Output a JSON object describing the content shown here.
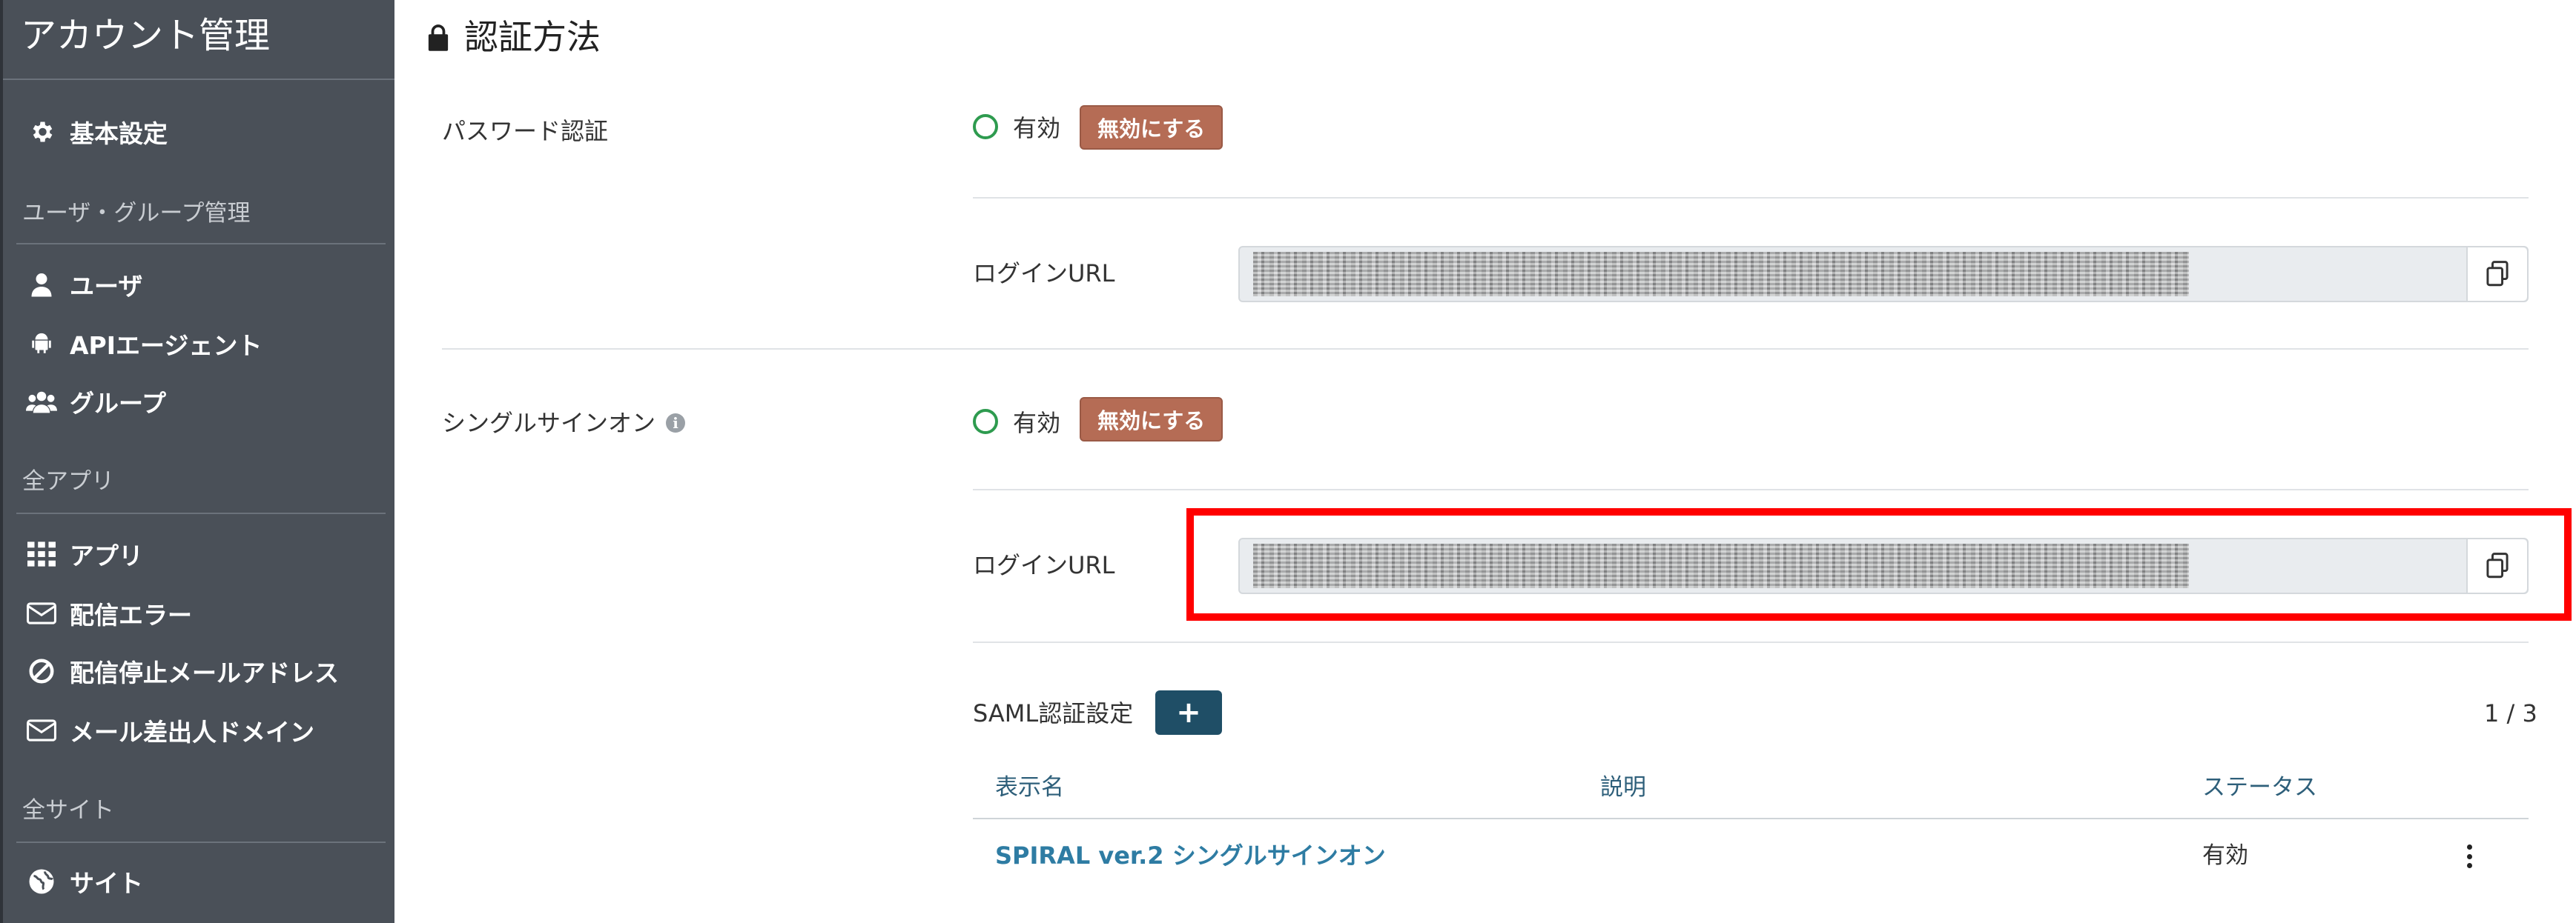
{
  "sidebar": {
    "title": "アカウント管理",
    "items": [
      {
        "label": "基本設定",
        "icon": "gear-icon"
      },
      {
        "label": "ユーザ",
        "icon": "user-icon"
      },
      {
        "label": "APIエージェント",
        "icon": "android-icon"
      },
      {
        "label": "グループ",
        "icon": "group-icon"
      },
      {
        "label": "アプリ",
        "icon": "grid-icon"
      },
      {
        "label": "配信エラー",
        "icon": "envelope-icon"
      },
      {
        "label": "配信停止メールアドレス",
        "icon": "ban-icon"
      },
      {
        "label": "メール差出人ドメイン",
        "icon": "envelope-icon"
      },
      {
        "label": "サイト",
        "icon": "globe-icon"
      }
    ],
    "sections": [
      "ユーザ・グループ管理",
      "全アプリ",
      "全サイト"
    ]
  },
  "main": {
    "title": "認証方法",
    "password_auth": {
      "label": "パスワード認証",
      "status": "有効",
      "disable_button": "無効にする",
      "login_url_label": "ログインURL"
    },
    "sso": {
      "label": "シングルサインオン",
      "status": "有効",
      "disable_button": "無効にする",
      "login_url_label": "ログインURL"
    },
    "saml": {
      "label": "SAML認証設定",
      "add_button": "+",
      "pagination": "1 / 3",
      "columns": [
        "表示名",
        "説明",
        "ステータス"
      ],
      "rows": [
        {
          "name": "SPIRAL ver.2 シングルサインオン",
          "description": "",
          "status": "有効"
        }
      ]
    }
  },
  "colors": {
    "sidebar_bg": "#4a5058",
    "disable_button": "#b56c55",
    "status_ok": "#2e9b4f",
    "link": "#2e7ca3",
    "highlight": "#ff0000",
    "add_button": "#1f4e66"
  }
}
